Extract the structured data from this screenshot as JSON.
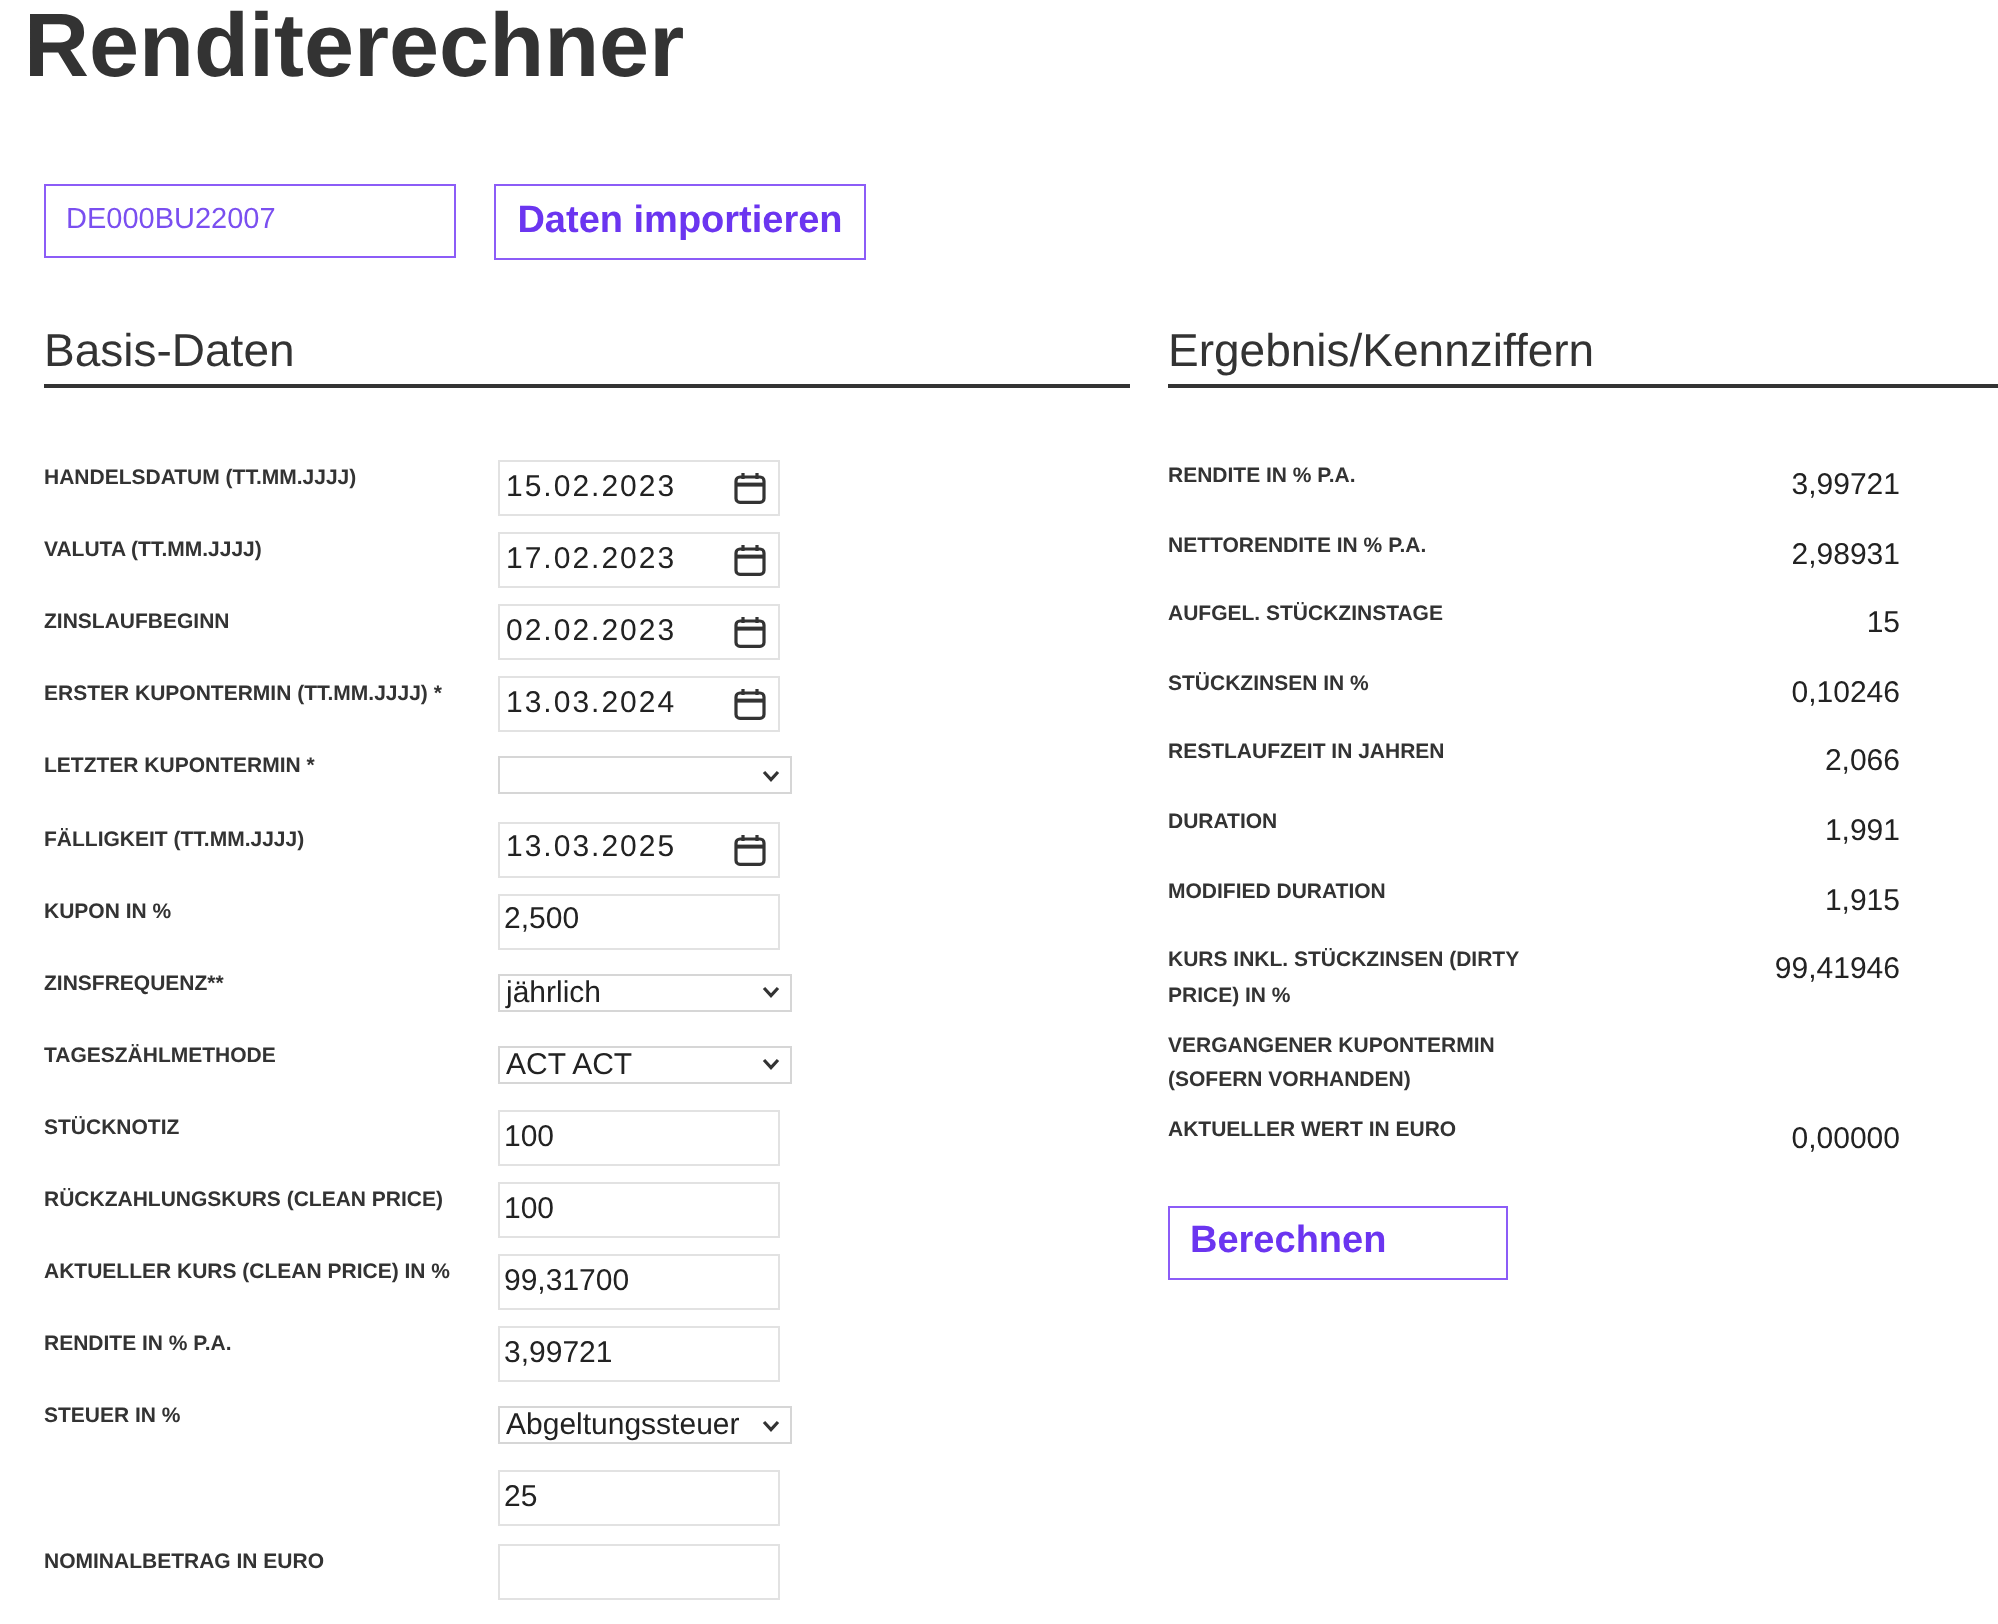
{
  "page": {
    "title": "Renditerechner"
  },
  "import": {
    "isin": "DE000BU22007",
    "button": "Daten importieren"
  },
  "basis_daten": {
    "title": "Basis-Daten",
    "fields": [
      {
        "label": "HANDELSDATUM (TT.MM.JJJJ)",
        "kind": "date",
        "value": "15.02.2023"
      },
      {
        "label": "VALUTA (TT.MM.JJJJ)",
        "kind": "date",
        "value": "17.02.2023"
      },
      {
        "label": "ZINSLAUFBEGINN",
        "kind": "date",
        "value": "02.02.2023"
      },
      {
        "label": "ERSTER KUPONTERMIN (TT.MM.JJJJ) *",
        "kind": "date",
        "value": "13.03.2024"
      },
      {
        "label": "LETZTER KUPONTERMIN *",
        "kind": "select"
      },
      {
        "label": "FÄLLIGKEIT (TT.MM.JJJJ)",
        "kind": "date",
        "value": "13.03.2025"
      },
      {
        "label": "KUPON IN %",
        "kind": "text",
        "value": "2,500"
      },
      {
        "label": "ZINSFREQUENZ**",
        "kind": "select",
        "value": "jährlich"
      },
      {
        "label": "TAGESZÄHLMETHODE",
        "kind": "select",
        "value": "ACT ACT"
      },
      {
        "label": "STÜCKNOTIZ",
        "kind": "text",
        "value": "100"
      },
      {
        "label": "RÜCKZAHLUNGSKURS (CLEAN PRICE)",
        "kind": "text",
        "value": "100"
      },
      {
        "label": "AKTUELLER KURS (CLEAN PRICE) IN %",
        "kind": "text",
        "value": "99,31700"
      },
      {
        "label": "RENDITE IN % P.A.",
        "kind": "text",
        "value": "3,99721"
      },
      {
        "label": "STEUER IN %",
        "kind": "select",
        "value": "Abgeltungssteuer"
      },
      {
        "kind": "text",
        "value": "25"
      },
      {
        "label": "NOMINALBETRAG IN EURO",
        "kind": "text"
      }
    ]
  },
  "ergebnis": {
    "title": "Ergebnis/Kennziffern",
    "rows": [
      {
        "label": "RENDITE IN % P.A.",
        "value": "3,99721"
      },
      {
        "label": "NETTORENDITE IN % P.A.",
        "value": "2,98931"
      },
      {
        "label": "AUFGEL. STÜCKZINSTAGE",
        "value": "15"
      },
      {
        "label": "STÜCKZINSEN IN %",
        "value": "0,10246"
      },
      {
        "label": "RESTLAUFZEIT IN JAHREN",
        "value": "2,066"
      },
      {
        "label": "DURATION",
        "value": "1,991"
      },
      {
        "label": "MODIFIED DURATION",
        "value": "1,915"
      },
      {
        "label": "KURS INKL. STÜCKZINSEN (DIRTY PRICE) IN %",
        "value": "99,41946"
      },
      {
        "label": "VERGANGENER KUPONTERMIN (SOFERN VORHANDEN)"
      },
      {
        "label": "AKTUELLER WERT IN EURO",
        "value": "0,00000"
      }
    ],
    "button": "Berechnen"
  }
}
